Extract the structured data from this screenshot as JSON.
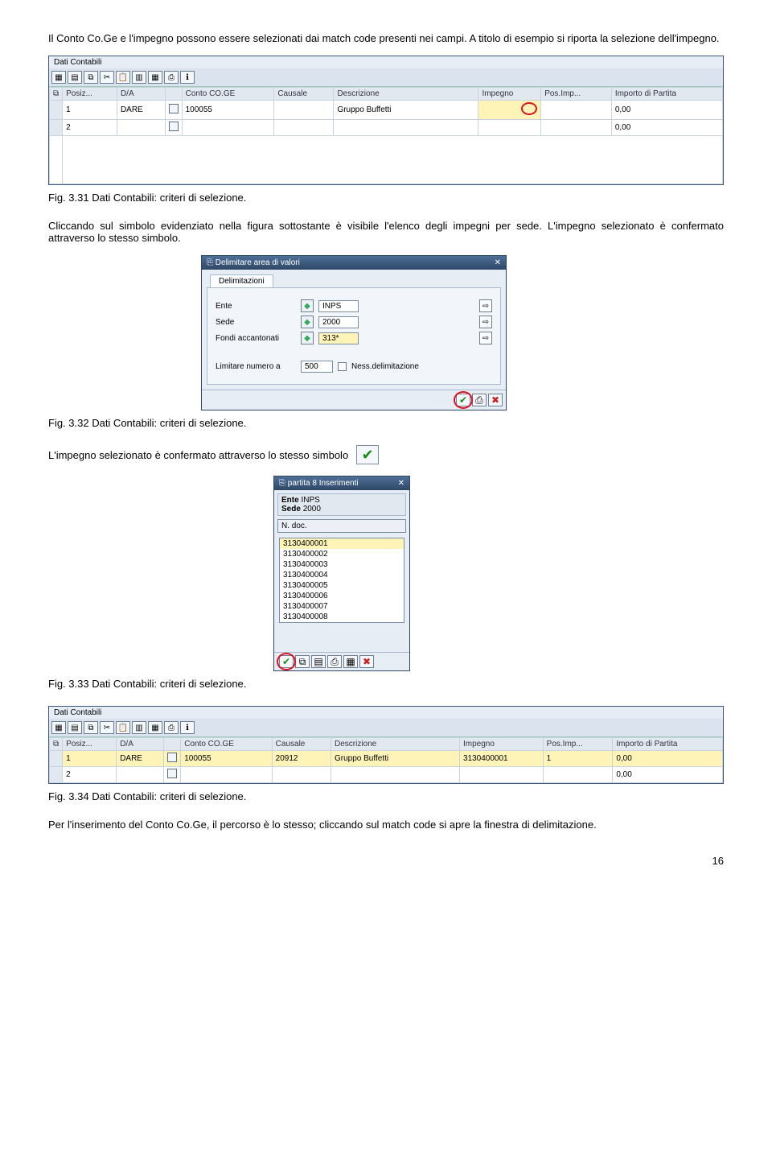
{
  "text": {
    "intro": "Il Conto Co.Ge e l'impegno possono essere selezionati dai match code presenti nei campi. A titolo di esempio si riporta la selezione dell'impegno.",
    "cap1": "Fig. 3.31 Dati Contabili: criteri di selezione.",
    "para2": "Cliccando sul simbolo evidenziato nella figura sottostante è visibile l'elenco degli impegni per sede. L'impegno selezionato è confermato attraverso lo stesso simbolo.",
    "cap2": "Fig. 3.32 Dati Contabili: criteri di selezione.",
    "para3": "L'impegno selezionato è confermato attraverso lo stesso simbolo",
    "cap3": "Fig. 3.33 Dati Contabili: criteri di selezione.",
    "cap4": "Fig. 3.34 Dati Contabili: criteri di selezione.",
    "para4": "Per l'inserimento del Conto Co.Ge, il percorso è lo stesso; cliccando sul match code si apre la finestra di delimitazione.",
    "page": "16"
  },
  "fig1": {
    "section": "Dati Contabili",
    "headers": [
      "Posiz...",
      "D/A",
      "",
      "Conto CO.GE",
      "Causale",
      "Descrizione",
      "Impegno",
      "Pos.Imp...",
      "Importo di Partita"
    ],
    "rows": [
      {
        "pos": "1",
        "da": "DARE",
        "conto": "100055",
        "causale": "",
        "descr": "Gruppo Buffetti",
        "impegno": "",
        "posimp": "",
        "importo": "0,00",
        "highlight_impegno": true
      },
      {
        "pos": "2",
        "da": "",
        "conto": "",
        "causale": "",
        "descr": "",
        "impegno": "",
        "posimp": "",
        "importo": "0,00",
        "highlight_impegno": false
      }
    ]
  },
  "fig2": {
    "title": "Delimitare area di valori",
    "tab": "Delimitazioni",
    "fields": [
      {
        "label": "Ente",
        "value": "INPS",
        "hl": false
      },
      {
        "label": "Sede",
        "value": "2000",
        "hl": false
      },
      {
        "label": "Fondi accantonati",
        "value": "313*",
        "hl": true
      }
    ],
    "limit_label": "Limitare numero a",
    "limit_value": "500",
    "limit_chk_label": "Ness.delimitazione"
  },
  "fig3": {
    "title": "partita 8 Inserimenti",
    "ente_lbl": "Ente",
    "ente_val": "INPS",
    "sede_lbl": "Sede",
    "sede_val": "2000",
    "ndoc": "N. doc.",
    "items": [
      "3130400001",
      "3130400002",
      "3130400003",
      "3130400004",
      "3130400005",
      "3130400006",
      "3130400007",
      "3130400008"
    ]
  },
  "fig4": {
    "section": "Dati Contabili",
    "headers": [
      "Posiz...",
      "D/A",
      "",
      "Conto CO.GE",
      "Causale",
      "Descrizione",
      "Impegno",
      "Pos.Imp...",
      "Importo di Partita"
    ],
    "rows": [
      {
        "pos": "1",
        "da": "DARE",
        "conto": "100055",
        "causale": "20912",
        "descr": "Gruppo Buffetti",
        "impegno": "3130400001",
        "posimp": "1",
        "importo": "0,00"
      },
      {
        "pos": "2",
        "da": "",
        "conto": "",
        "causale": "",
        "descr": "",
        "impegno": "",
        "posimp": "",
        "importo": "0,00"
      }
    ]
  }
}
